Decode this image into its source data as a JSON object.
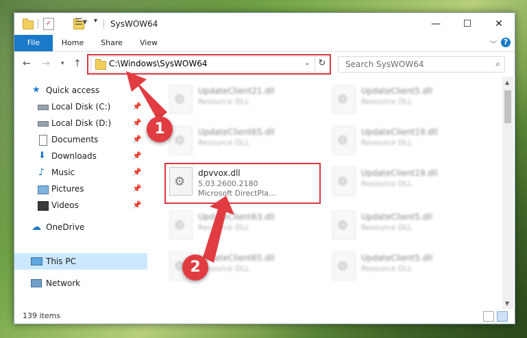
{
  "window": {
    "title": "SysWOW64"
  },
  "ribbon": {
    "tabs": [
      "File",
      "Home",
      "Share",
      "View"
    ],
    "help": "?"
  },
  "address": {
    "path": "C:\\Windows\\SysWOW64"
  },
  "search": {
    "placeholder": "Search SysWOW64"
  },
  "nav": {
    "items": [
      {
        "label": "Quick access",
        "icon": "star-icon"
      },
      {
        "label": "Local Disk (C:)",
        "icon": "drive-icon"
      },
      {
        "label": "Local Disk (D:)",
        "icon": "drive-icon"
      },
      {
        "label": "Documents",
        "icon": "documents-icon"
      },
      {
        "label": "Downloads",
        "icon": "download-icon"
      },
      {
        "label": "Music",
        "icon": "music-icon"
      },
      {
        "label": "Pictures",
        "icon": "pictures-icon"
      },
      {
        "label": "Videos",
        "icon": "videos-icon"
      },
      {
        "label": "OneDrive",
        "icon": "cloud-icon"
      },
      {
        "label": "This PC",
        "icon": "computer-icon"
      },
      {
        "label": "Network",
        "icon": "network-icon"
      }
    ]
  },
  "files": [
    {
      "name": "UpdateClient21.dll",
      "type": "Resource DLL"
    },
    {
      "name": "UpdateClient5.dll",
      "type": "Resource DLL"
    },
    {
      "name": "UpdateClient65.dll",
      "type": "Resource DLL"
    },
    {
      "name": "UpdateClient19.dll",
      "type": "Resource DLL"
    },
    {
      "name": "dpvvox.dll",
      "version": "5.03.2600.2180",
      "company": "Microsoft DirectPla..."
    },
    {
      "name": "UpdateClient19.dll",
      "type": "Resource DLL"
    },
    {
      "name": "UpdateClient63.dll",
      "type": "Resource DLL"
    },
    {
      "name": "UpdateClient5.dll",
      "type": "Resource DLL"
    },
    {
      "name": "UpdateClient65.dll",
      "type": "Resource DLL"
    },
    {
      "name": "UpdateClient5.dll",
      "type": "Resource DLL"
    }
  ],
  "status": {
    "count": "139 items"
  },
  "callouts": [
    "1",
    "2"
  ],
  "colors": {
    "accent": "#1979ca",
    "highlight": "#d9363e",
    "callout": "#e03c41",
    "selected": "#cce8ff"
  }
}
